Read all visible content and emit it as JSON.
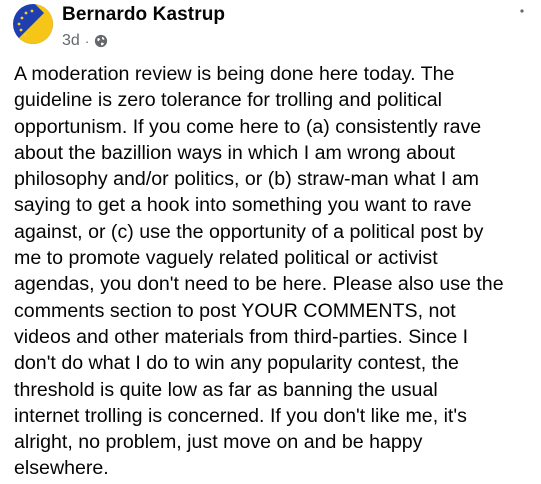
{
  "post": {
    "author": "Bernardo Kastrup",
    "timestamp": "3d",
    "separator": "·",
    "privacy_icon": "globe-icon",
    "more_icon": "more-options-icon",
    "avatar_colors": {
      "blue": "#1f3fb0",
      "yellow": "#f5c518",
      "stars": "#f5d020"
    },
    "lines": [
      "A moderation review is being done here today. The",
      "guideline is zero tolerance for trolling and political",
      "opportunism. If you come here to (a) consistently rave",
      "about the bazillion ways in which I am wrong about",
      "philosophy and/or politics, or (b) straw-man what I am",
      "saying to get a hook into something you want to rave",
      "against, or (c) use the opportunity of a political post by",
      "me to promote vaguely related political or activist",
      "agendas, you don't need to be here. Please also use the",
      "comments section to post YOUR COMMENTS, not",
      "videos and other materials from third-parties. Since I",
      "don't do what I do to win any popularity contest, the",
      "threshold is quite low as far as banning the usual",
      "internet trolling is concerned. If you don't like me, it's",
      "alright, no problem, just move on and be happy",
      "elsewhere."
    ]
  }
}
